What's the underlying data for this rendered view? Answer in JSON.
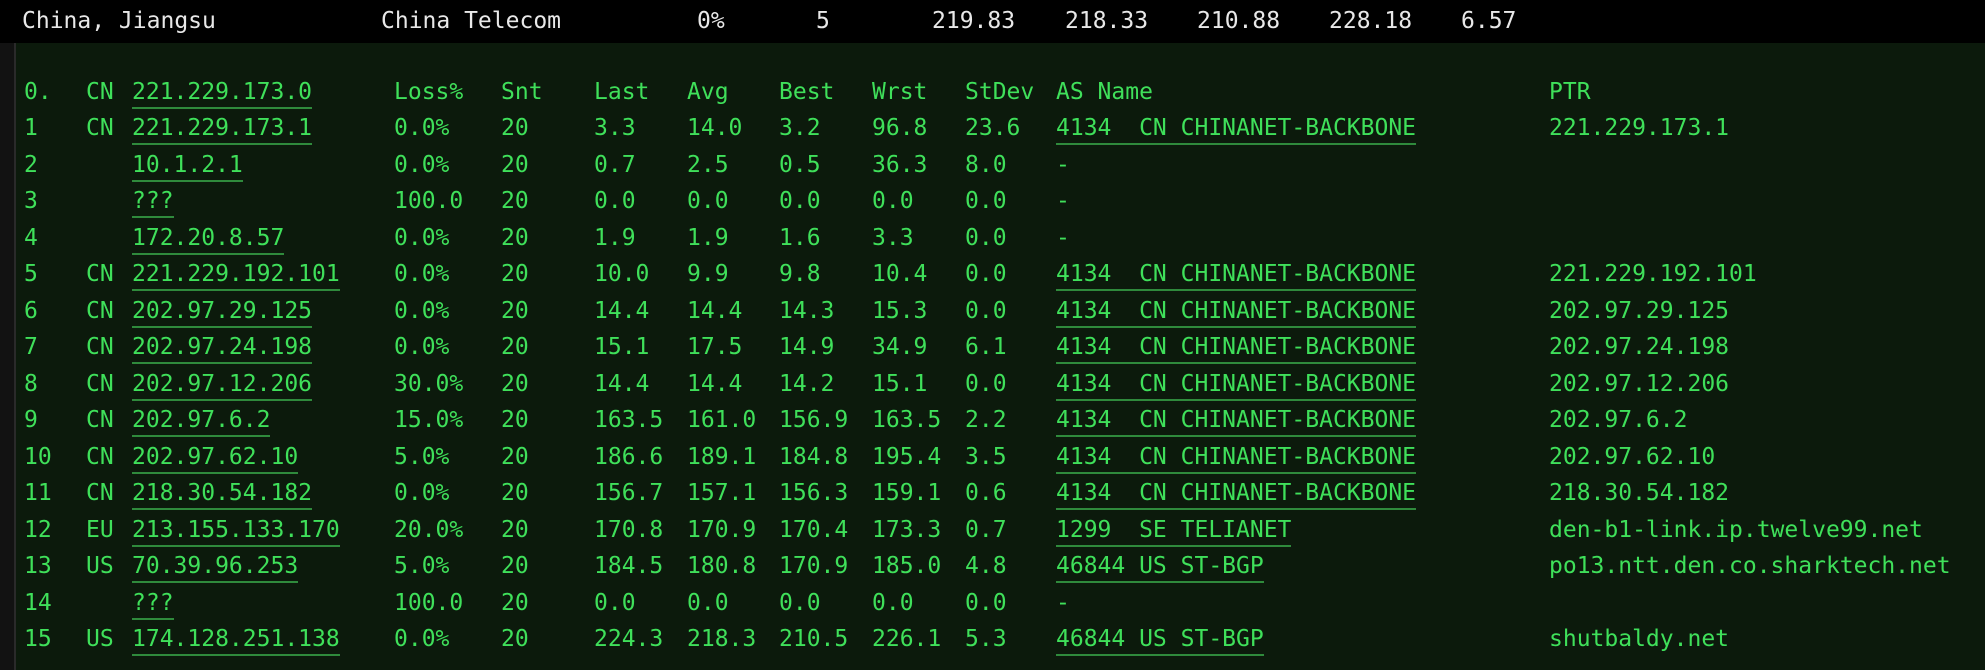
{
  "summary": {
    "location": "China, Jiangsu",
    "isp": "China Telecom",
    "loss": "0%",
    "sent": "5",
    "last": "219.83",
    "avg": "218.33",
    "best": "210.88",
    "worst": "228.18",
    "stdev": "6.57"
  },
  "header": {
    "hop": "0.",
    "cc": "CN",
    "ip": "221.229.173.0",
    "loss": "Loss%",
    "snt": "Snt",
    "last": "Last",
    "avg": "Avg",
    "best": "Best",
    "wrst": "Wrst",
    "stdev": "StDev",
    "as": "AS Name",
    "ptr": "PTR"
  },
  "hops": [
    {
      "hop": "1",
      "cc": "CN",
      "ip": "221.229.173.1",
      "loss": "0.0%",
      "snt": "20",
      "last": "3.3",
      "avg": "14.0",
      "best": "3.2",
      "wrst": "96.8",
      "stdev": "23.6",
      "as": "4134  CN CHINANET-BACKBONE",
      "ptr": "221.229.173.1"
    },
    {
      "hop": "2",
      "cc": "",
      "ip": "10.1.2.1",
      "loss": "0.0%",
      "snt": "20",
      "last": "0.7",
      "avg": "2.5",
      "best": "0.5",
      "wrst": "36.3",
      "stdev": "8.0",
      "as": "-",
      "ptr": ""
    },
    {
      "hop": "3",
      "cc": "",
      "ip": "???",
      "loss": "100.0",
      "snt": "20",
      "last": "0.0",
      "avg": "0.0",
      "best": "0.0",
      "wrst": "0.0",
      "stdev": "0.0",
      "as": "-",
      "ptr": ""
    },
    {
      "hop": "4",
      "cc": "",
      "ip": "172.20.8.57",
      "loss": "0.0%",
      "snt": "20",
      "last": "1.9",
      "avg": "1.9",
      "best": "1.6",
      "wrst": "3.3",
      "stdev": "0.0",
      "as": "-",
      "ptr": ""
    },
    {
      "hop": "5",
      "cc": "CN",
      "ip": "221.229.192.101",
      "loss": "0.0%",
      "snt": "20",
      "last": "10.0",
      "avg": "9.9",
      "best": "9.8",
      "wrst": "10.4",
      "stdev": "0.0",
      "as": "4134  CN CHINANET-BACKBONE",
      "ptr": "221.229.192.101"
    },
    {
      "hop": "6",
      "cc": "CN",
      "ip": "202.97.29.125",
      "loss": "0.0%",
      "snt": "20",
      "last": "14.4",
      "avg": "14.4",
      "best": "14.3",
      "wrst": "15.3",
      "stdev": "0.0",
      "as": "4134  CN CHINANET-BACKBONE",
      "ptr": "202.97.29.125"
    },
    {
      "hop": "7",
      "cc": "CN",
      "ip": "202.97.24.198",
      "loss": "0.0%",
      "snt": "20",
      "last": "15.1",
      "avg": "17.5",
      "best": "14.9",
      "wrst": "34.9",
      "stdev": "6.1",
      "as": "4134  CN CHINANET-BACKBONE",
      "ptr": "202.97.24.198"
    },
    {
      "hop": "8",
      "cc": "CN",
      "ip": "202.97.12.206",
      "loss": "30.0%",
      "snt": "20",
      "last": "14.4",
      "avg": "14.4",
      "best": "14.2",
      "wrst": "15.1",
      "stdev": "0.0",
      "as": "4134  CN CHINANET-BACKBONE",
      "ptr": "202.97.12.206"
    },
    {
      "hop": "9",
      "cc": "CN",
      "ip": "202.97.6.2",
      "loss": "15.0%",
      "snt": "20",
      "last": "163.5",
      "avg": "161.0",
      "best": "156.9",
      "wrst": "163.5",
      "stdev": "2.2",
      "as": "4134  CN CHINANET-BACKBONE",
      "ptr": "202.97.6.2"
    },
    {
      "hop": "10",
      "cc": "CN",
      "ip": "202.97.62.10",
      "loss": "5.0%",
      "snt": "20",
      "last": "186.6",
      "avg": "189.1",
      "best": "184.8",
      "wrst": "195.4",
      "stdev": "3.5",
      "as": "4134  CN CHINANET-BACKBONE",
      "ptr": "202.97.62.10"
    },
    {
      "hop": "11",
      "cc": "CN",
      "ip": "218.30.54.182",
      "loss": "0.0%",
      "snt": "20",
      "last": "156.7",
      "avg": "157.1",
      "best": "156.3",
      "wrst": "159.1",
      "stdev": "0.6",
      "as": "4134  CN CHINANET-BACKBONE",
      "ptr": "218.30.54.182"
    },
    {
      "hop": "12",
      "cc": "EU",
      "ip": "213.155.133.170",
      "loss": "20.0%",
      "snt": "20",
      "last": "170.8",
      "avg": "170.9",
      "best": "170.4",
      "wrst": "173.3",
      "stdev": "0.7",
      "as": "1299  SE TELIANET",
      "ptr": "den-b1-link.ip.twelve99.net"
    },
    {
      "hop": "13",
      "cc": "US",
      "ip": "70.39.96.253",
      "loss": "5.0%",
      "snt": "20",
      "last": "184.5",
      "avg": "180.8",
      "best": "170.9",
      "wrst": "185.0",
      "stdev": "4.8",
      "as": "46844 US ST-BGP",
      "ptr": "po13.ntt.den.co.sharktech.net"
    },
    {
      "hop": "14",
      "cc": "",
      "ip": "???",
      "loss": "100.0",
      "snt": "20",
      "last": "0.0",
      "avg": "0.0",
      "best": "0.0",
      "wrst": "0.0",
      "stdev": "0.0",
      "as": "-",
      "ptr": ""
    },
    {
      "hop": "15",
      "cc": "US",
      "ip": "174.128.251.138",
      "loss": "0.0%",
      "snt": "20",
      "last": "224.3",
      "avg": "218.3",
      "best": "210.5",
      "wrst": "226.1",
      "stdev": "5.3",
      "as": "46844 US ST-BGP",
      "ptr": "shutbaldy.net"
    }
  ]
}
